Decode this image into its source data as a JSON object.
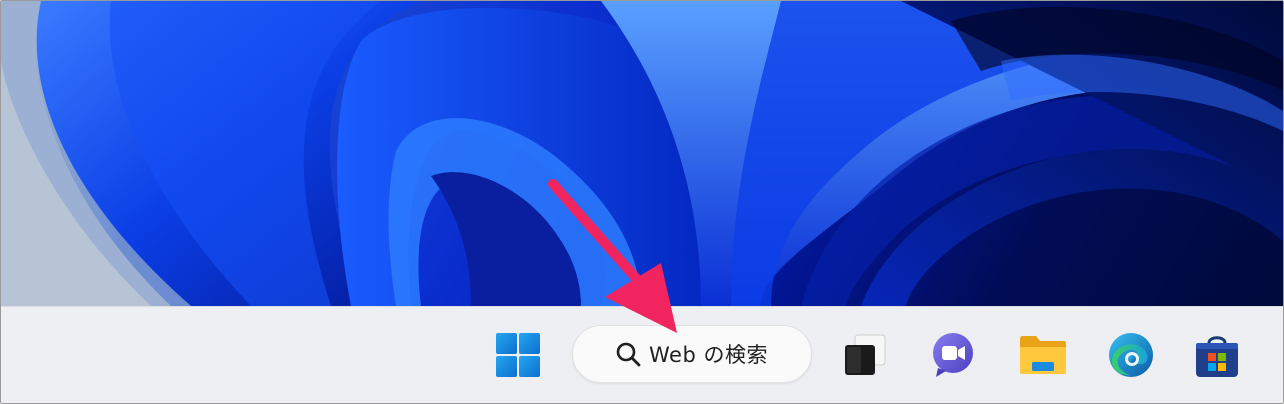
{
  "taskbar": {
    "search": {
      "label": "Web の検索",
      "icon": "search-icon"
    },
    "apps": [
      {
        "name": "start-button",
        "icon": "windows-logo-icon"
      },
      {
        "name": "task-view-button",
        "icon": "task-view-icon"
      },
      {
        "name": "teams-chat-button",
        "icon": "teams-chat-icon"
      },
      {
        "name": "file-explorer-button",
        "icon": "folder-icon"
      },
      {
        "name": "edge-button",
        "icon": "edge-icon"
      },
      {
        "name": "store-button",
        "icon": "microsoft-store-icon"
      }
    ]
  },
  "colors": {
    "taskbar_bg": "#eeeff2",
    "windows_blue": "#0a84d8",
    "annotation_arrow": "#f0245f"
  }
}
